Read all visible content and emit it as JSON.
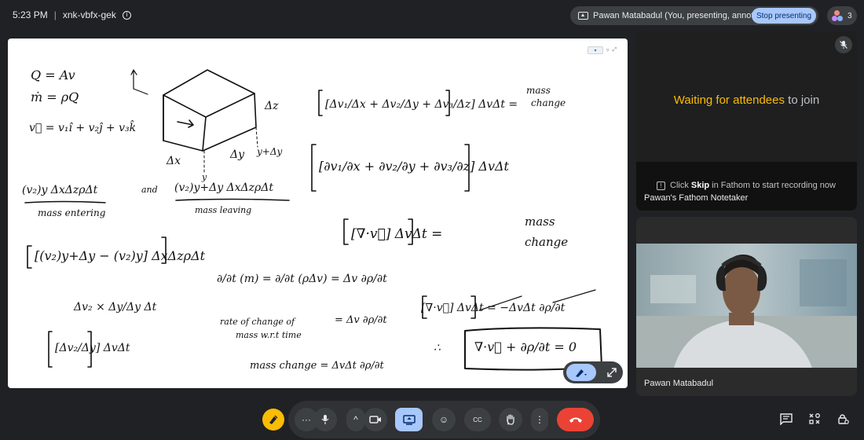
{
  "meeting": {
    "time": "5:23 PM",
    "separator": "|",
    "code": "xnk-vbfx-gek",
    "info_icon": "info-icon"
  },
  "presenting": {
    "label": "Pawan Matabadul (You, presenting, annotating)",
    "icon": "present-screen-icon",
    "stop_label": "Stop presenting"
  },
  "participants": {
    "count": "3",
    "icon": "people-icon"
  },
  "whiteboard": {
    "lines": [
      "Q = Av",
      "ṁ = ρQ",
      "v⃗ = v₁î + v₂ĵ + v₃k̂",
      "Δz",
      "Δx",
      "Δy",
      "y+Δy",
      "y",
      "(v₂)y ΔxΔzρΔt",
      "mass entering",
      "and",
      "(v₂)y+Δy ΔxΔzρΔt",
      "mass leaving",
      "[(v₂)y+Δy − (v₂)y] ΔxΔzρΔt",
      "Δv₂ × Δy/Δy Δt",
      "[Δv₂/Δy] ΔvΔt",
      "[Δv₁/Δx + Δv₂/Δy + Δv₃/Δz] ΔvΔt =",
      "mass",
      "change",
      "[∂v₁/∂x + ∂v₂/∂y + ∂v₃/∂z] ΔvΔt",
      "[∇·v⃗] ΔvΔt =",
      "mass",
      "change",
      "∂/∂t (m) = ∂/∂t (ρΔv) = Δv ∂ρ/∂t",
      "rate of change of",
      "mass w.r.t time",
      "= Δv ∂ρ/∂t",
      "mass change = ΔvΔt ∂ρ/∂t",
      "[∇·v⃗] ΔvΔt = −ΔvΔt ∂ρ/∂t",
      "∴",
      "∇·v⃗ + ∂ρ/∂t = 0"
    ],
    "toolbar_chip": "▾",
    "toolbar_glyphs": [
      "▿",
      "⤢"
    ]
  },
  "annotate": {
    "pen_icon": "pen-annotate-icon",
    "expand_icon": "expand-icon"
  },
  "waiting_tile": {
    "highlight": "Waiting for attendees",
    "rest": " to join",
    "mute_icon": "mic-off-icon",
    "skip_prefix": "Click ",
    "skip_bold": "Skip",
    "skip_suffix": " in Fathom to start recording now",
    "name": "Pawan's Fathom Notetaker"
  },
  "camera_tile": {
    "name": "Pawan Matabadul"
  },
  "controls": {
    "items": [
      {
        "name": "more-options-dots-icon",
        "glyph": "···"
      },
      {
        "name": "mic-icon",
        "glyph": "🎙"
      },
      {
        "name": "chevron-up-icon",
        "glyph": "^"
      },
      {
        "name": "camera-icon",
        "glyph": "▭"
      },
      {
        "name": "present-icon",
        "glyph": "▣"
      },
      {
        "name": "emoji-icon",
        "glyph": "☺"
      },
      {
        "name": "captions-icon",
        "glyph": "CC"
      },
      {
        "name": "raise-hand-icon",
        "glyph": "✋"
      },
      {
        "name": "more-vert-icon",
        "glyph": "⋮"
      },
      {
        "name": "end-call-icon",
        "glyph": "✆"
      }
    ]
  },
  "right_icons": [
    "chat-icon",
    "activities-icon",
    "host-controls-icon"
  ],
  "colors": {
    "background": "#202124",
    "accent": "#a8c7fa",
    "end_call": "#ea4335",
    "waiting_highlight": "#fbbc04"
  }
}
